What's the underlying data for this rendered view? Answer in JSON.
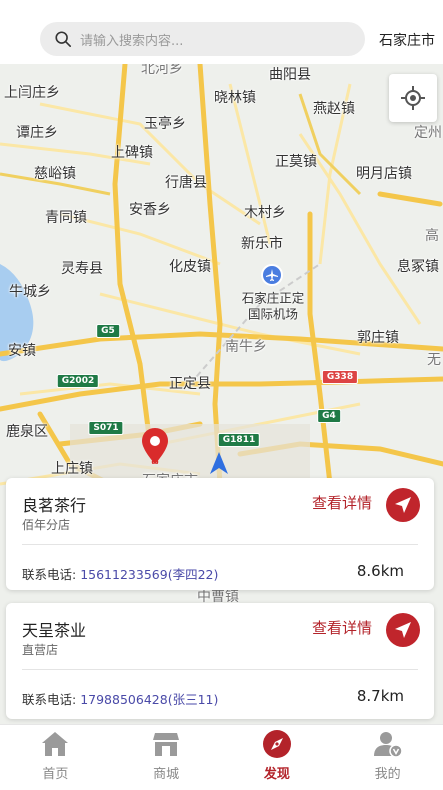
{
  "header": {
    "search_placeholder": "请输入搜索内容...",
    "city": "石家庄市"
  },
  "map": {
    "places": [
      {
        "name": "北河乡",
        "cls": "place partial"
      },
      {
        "name": "曲阳县",
        "cls": "place"
      },
      {
        "name": "上闫庄乡",
        "cls": "place"
      },
      {
        "name": "晓林镇",
        "cls": "place"
      },
      {
        "name": "燕赵镇",
        "cls": "place"
      },
      {
        "name": "玉亭乡",
        "cls": "place"
      },
      {
        "name": "谭庄乡",
        "cls": "place"
      },
      {
        "name": "上碑镇",
        "cls": "place"
      },
      {
        "name": "定州",
        "cls": "place partial"
      },
      {
        "name": "慈峪镇",
        "cls": "place"
      },
      {
        "name": "正莫镇",
        "cls": "place"
      },
      {
        "name": "行唐县",
        "cls": "place"
      },
      {
        "name": "明月店镇",
        "cls": "place"
      },
      {
        "name": "青同镇",
        "cls": "place"
      },
      {
        "name": "安香乡",
        "cls": "place"
      },
      {
        "name": "木村乡",
        "cls": "place"
      },
      {
        "name": "高",
        "cls": "place partial"
      },
      {
        "name": "新乐市",
        "cls": "place"
      },
      {
        "name": "灵寿县",
        "cls": "place"
      },
      {
        "name": "化皮镇",
        "cls": "place"
      },
      {
        "name": "息冢镇",
        "cls": "place"
      },
      {
        "name": "牛城乡",
        "cls": "place"
      },
      {
        "name": "石家庄正定",
        "cls": "place sm"
      },
      {
        "name": "国际机场",
        "cls": "place sm"
      },
      {
        "name": "郭庄镇",
        "cls": "place"
      },
      {
        "name": "安镇",
        "cls": "place"
      },
      {
        "name": "南牛乡",
        "cls": "place partial"
      },
      {
        "name": "无",
        "cls": "place partial"
      },
      {
        "name": "正定县",
        "cls": "place"
      },
      {
        "name": "鹿泉区",
        "cls": "place"
      },
      {
        "name": "上庄镇",
        "cls": "place"
      },
      {
        "name": "石家庄市",
        "cls": "place partial"
      },
      {
        "name": "中曹镇",
        "cls": "place partial"
      }
    ],
    "shields": [
      {
        "label": "G5",
        "cls": "shield g2"
      },
      {
        "label": "G2002",
        "cls": "shield g2"
      },
      {
        "label": "G338",
        "cls": "shield red"
      },
      {
        "label": "G4",
        "cls": "shield g2"
      },
      {
        "label": "S071",
        "cls": "shield g2"
      },
      {
        "label": "G1811",
        "cls": "shield g2"
      }
    ]
  },
  "stores": [
    {
      "name": "良茗茶行",
      "type": "佰年分店",
      "detail_label": "查看详情",
      "phone_label": "联系电话:",
      "phone": "15611233569",
      "contact": "(李四22)",
      "distance": "8.6km"
    },
    {
      "name": "天呈茶业",
      "type": "直营店",
      "detail_label": "查看详情",
      "phone_label": "联系电话:",
      "phone": "17988506428",
      "contact": "(张三11)",
      "distance": "8.7km"
    }
  ],
  "tabs": [
    {
      "label": "首页",
      "icon": "home-icon",
      "active": false
    },
    {
      "label": "商城",
      "icon": "shop-icon",
      "active": false
    },
    {
      "label": "发现",
      "icon": "compass-icon",
      "active": true
    },
    {
      "label": "我的",
      "icon": "user-icon",
      "active": false
    }
  ],
  "colors": {
    "accent": "#b3232a",
    "phone": "#4a4aa8",
    "road_major": "#f4c64a",
    "road_minor": "#fbe7a6",
    "map_bg": "#eef0ec"
  }
}
